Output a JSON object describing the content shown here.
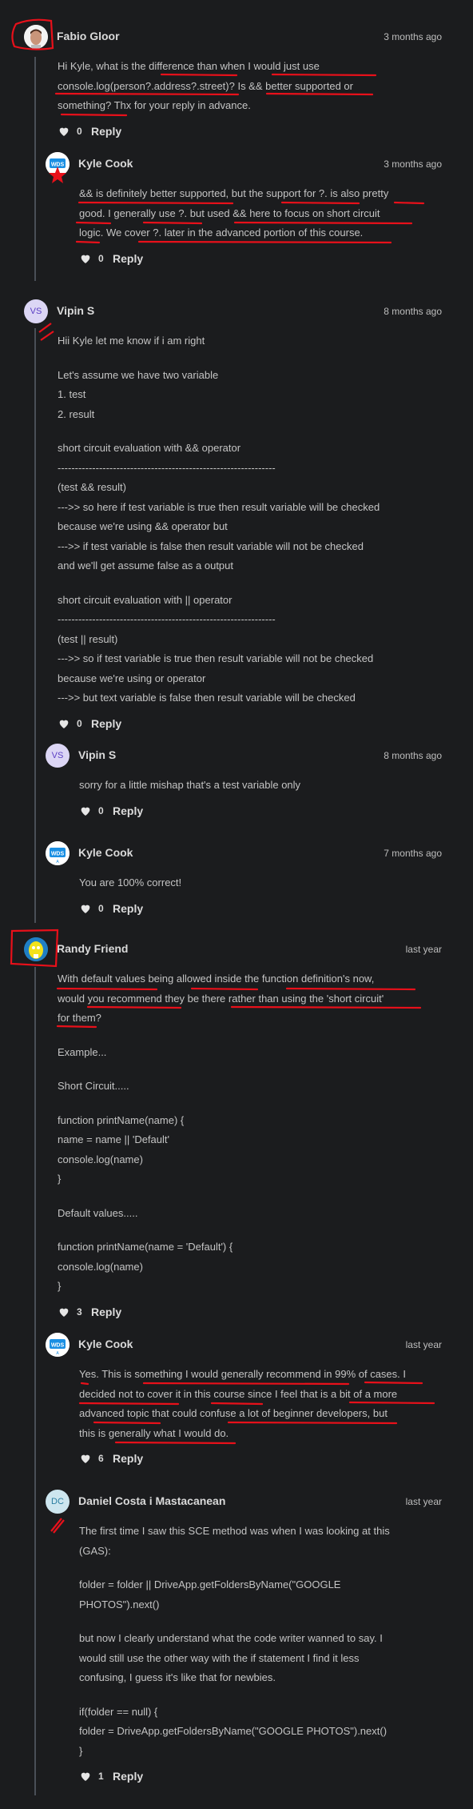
{
  "colors": {
    "background": "#1b1c1e",
    "annotation": "#e8101a",
    "thread_line": "#4a4f57"
  },
  "comments": [
    {
      "author": "Fabio Gloor",
      "avatar": "photo",
      "time": "3 months ago",
      "lines": [
        "Hi Kyle, what is the difference than when I would just use",
        "console.log(person?.address?.street)? Is && better supported or",
        "something? Thx for your reply in advance."
      ],
      "likes": "0",
      "reply": "Reply"
    },
    {
      "author": "Kyle Cook",
      "avatar": "wds-logo",
      "time": "3 months ago",
      "lines": [
        "&& is definitely better supported, but the support for ?. is also pretty",
        "good. I generally use ?. but used && here to focus on short circuit",
        "logic. We cover ?. later in the advanced portion of this course."
      ],
      "likes": "0",
      "reply": "Reply"
    },
    {
      "author": "Vipin S",
      "avatar": "VS",
      "time": "8 months ago",
      "lines": [
        "Hii Kyle let me know if i am right",
        "",
        "Let's assume we have two variable",
        "1. test",
        "2. result",
        "",
        "short circuit evaluation with && operator",
        "---------------------------------------------------------------",
        "(test && result)",
        "--->> so here if test variable is true then result variable will be checked",
        "because we're using && operator but",
        "--->> if test variable is false then result variable will not be checked",
        "and we'll get assume false as a output",
        "",
        "short circuit evaluation with || operator",
        "---------------------------------------------------------------",
        "(test || result)",
        "--->> so if test variable is true then result variable will not be checked",
        "because we're using or operator",
        "--->> but text variable is false then result variable will be checked"
      ],
      "likes": "0",
      "reply": "Reply"
    },
    {
      "author": "Vipin S",
      "avatar": "VS",
      "time": "8 months ago",
      "lines": [
        "sorry for a little mishap that's a test variable only"
      ],
      "likes": "0",
      "reply": "Reply"
    },
    {
      "author": "Kyle Cook",
      "avatar": "wds-logo",
      "time": "7 months ago",
      "lines": [
        "You are 100% correct!"
      ],
      "likes": "0",
      "reply": "Reply"
    },
    {
      "author": "Randy Friend",
      "avatar": "yellow-mm-character",
      "time": "last year",
      "lines": [
        "With default values being allowed inside the function definition's now,",
        "would you recommend they be there rather than using the 'short circuit'",
        "for them?",
        "",
        "Example...",
        "",
        "Short Circuit.....",
        "",
        "function printName(name) {",
        "name = name || 'Default'",
        "console.log(name)",
        "}",
        "",
        "Default values.....",
        "",
        "function printName(name = 'Default') {",
        "console.log(name)",
        "}"
      ],
      "likes": "3",
      "reply": "Reply"
    },
    {
      "author": "Kyle Cook",
      "avatar": "wds-logo",
      "time": "last year",
      "lines": [
        "Yes. This is something I would generally recommend in 99% of cases. I",
        "decided not to cover it in this course since I feel that is a bit of a more",
        "advanced topic that could confuse a lot of beginner developers, but",
        "this is generally what I would do."
      ],
      "likes": "6",
      "reply": "Reply"
    },
    {
      "author": "Daniel Costa i Mastacanean",
      "avatar": "DC",
      "time": "last year",
      "lines": [
        "The first time I saw this SCE method was when I was looking at this",
        "(GAS):",
        "",
        "folder = folder || DriveApp.getFoldersByName(\"GOOGLE",
        "PHOTOS\").next()",
        "",
        "but now I clearly understand what the code writer wanned to say. I",
        "would still use the other way with the if statement I find it less",
        "confusing, I guess it's like that for newbies.",
        "",
        "if(folder == null) {",
        "folder = DriveApp.getFoldersByName(\"GOOGLE PHOTOS\").next()",
        "}"
      ],
      "likes": "1",
      "reply": "Reply"
    }
  ]
}
